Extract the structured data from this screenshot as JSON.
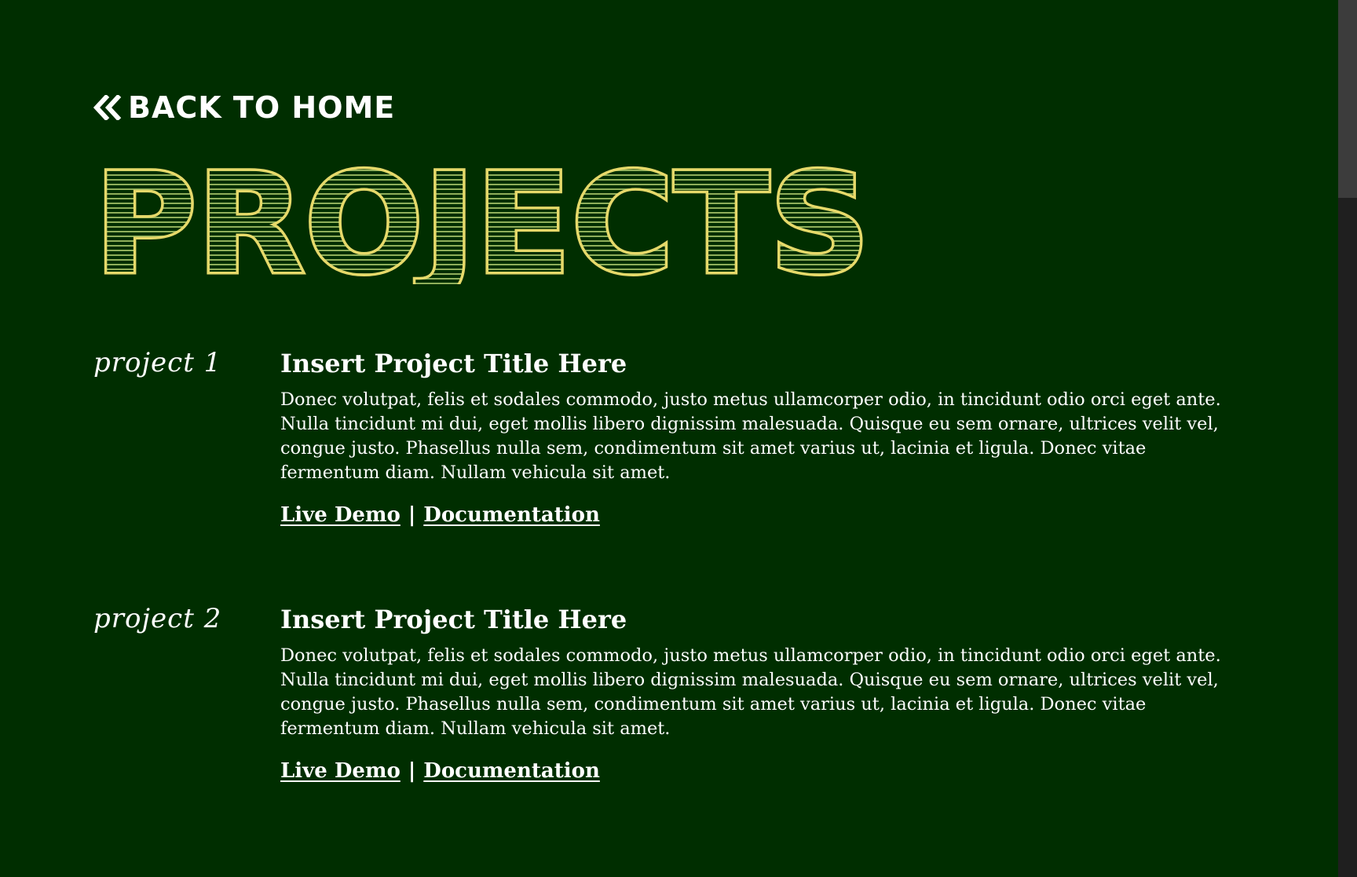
{
  "nav": {
    "back_label": "BACK TO HOME"
  },
  "page": {
    "title": "PROJECTS"
  },
  "colors": {
    "background": "#002e00",
    "title_outline": "#e6d96a",
    "text": "#ffffff"
  },
  "projects": [
    {
      "number_label": "project 1",
      "title": "Insert Project Title Here",
      "description": "Donec volutpat, felis et sodales commodo, justo metus ullamcorper odio, in tincidunt odio orci eget ante. Nulla tincidunt mi dui, eget mollis libero dignissim malesuada. Quisque eu sem ornare, ultrices velit vel, congue justo. Phasellus nulla sem, condimentum sit amet varius ut, lacinia et ligula. Donec vitae fermentum diam. Nullam vehicula sit amet.",
      "live_demo_label": "Live Demo",
      "separator": "|",
      "docs_label": "Documentation"
    },
    {
      "number_label": "project 2",
      "title": "Insert Project Title Here",
      "description": "Donec volutpat, felis et sodales commodo, justo metus ullamcorper odio, in tincidunt odio orci eget ante. Nulla tincidunt mi dui, eget mollis libero dignissim malesuada. Quisque eu sem ornare, ultrices velit vel, congue justo. Phasellus nulla sem, condimentum sit amet varius ut, lacinia et ligula. Donec vitae fermentum diam. Nullam vehicula sit amet.",
      "live_demo_label": "Live Demo",
      "separator": "|",
      "docs_label": "Documentation"
    }
  ]
}
